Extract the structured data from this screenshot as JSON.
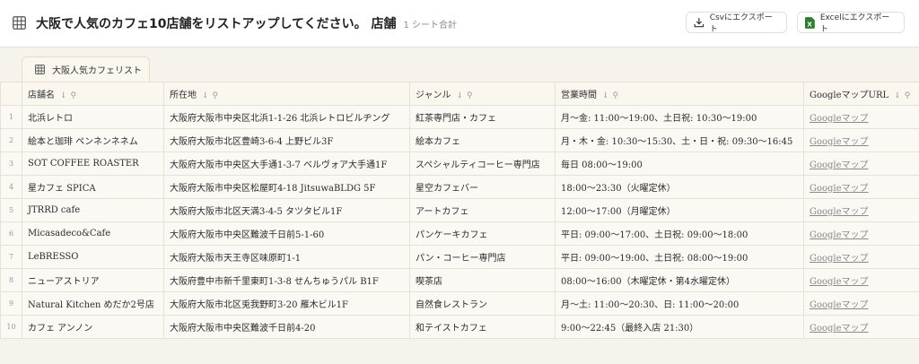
{
  "header": {
    "title": "大阪で人気のカフェ10店舗をリストアップしてください。 店舗",
    "sheet_count": "1 シート合計",
    "csv_label": "Csvにエクスポート",
    "excel_label": "Excelにエクスポート",
    "excel_color": "#2e7d32"
  },
  "tab": {
    "label": "大阪人気カフェリスト"
  },
  "table": {
    "columns": [
      "店舗名",
      "所在地",
      "ジャンル",
      "営業時間",
      "GoogleマップURL"
    ],
    "sort_glyph": "↓",
    "pin_glyph": "⚲",
    "rows": [
      {
        "n": "1",
        "name": "北浜レトロ",
        "address": "大阪府大阪市中央区北浜1-1-26 北浜レトロビルヂング",
        "genre": "紅茶専門店・カフェ",
        "hours": "月～金: 11:00～19:00、土日祝: 10:30～19:00",
        "url": "Googleマップ"
      },
      {
        "n": "2",
        "name": "絵本と珈琲 ペンネンネネム",
        "address": "大阪府大阪市北区豊崎3-6-4 上野ビル3F",
        "genre": "絵本カフェ",
        "hours": "月・木・金: 10:30～15:30、土・日・祝: 09:30～16:45",
        "url": "Googleマップ"
      },
      {
        "n": "3",
        "name": "SOT COFFEE ROASTER",
        "address": "大阪府大阪市中央区大手通1-3-7 ベルヴォア大手通1F",
        "genre": "スペシャルティコーヒー専門店",
        "hours": "毎日 08:00～19:00",
        "url": "Googleマップ"
      },
      {
        "n": "4",
        "name": "星カフェ SPICA",
        "address": "大阪府大阪市中央区松屋町4-18 JitsuwaBLDG 5F",
        "genre": "星空カフェバー",
        "hours": "18:00～23:30（火曜定休）",
        "url": "Googleマップ"
      },
      {
        "n": "5",
        "name": "JTRRD cafe",
        "address": "大阪府大阪市北区天満3-4-5 タツタビル1F",
        "genre": "アートカフェ",
        "hours": "12:00～17:00（月曜定休）",
        "url": "Googleマップ"
      },
      {
        "n": "6",
        "name": "Micasadeco&Cafe",
        "address": "大阪府大阪市中央区難波千日前5-1-60",
        "genre": "パンケーキカフェ",
        "hours": "平日: 09:00～17:00、土日祝: 09:00～18:00",
        "url": "Googleマップ"
      },
      {
        "n": "7",
        "name": "LeBRESSO",
        "address": "大阪府大阪市天王寺区味原町1-1",
        "genre": "パン・コーヒー専門店",
        "hours": "平日: 09:00～19:00、土日祝: 08:00～19:00",
        "url": "Googleマップ"
      },
      {
        "n": "8",
        "name": "ニューアストリア",
        "address": "大阪府豊中市新千里東町1-3-8 せんちゅうパル B1F",
        "genre": "喫茶店",
        "hours": "08:00～16:00（木曜定休・第4水曜定休）",
        "url": "Googleマップ"
      },
      {
        "n": "9",
        "name": "Natural Kitchen めだか2号店",
        "address": "大阪府大阪市北区兎我野町3-20 雁木ビル1F",
        "genre": "自然食レストラン",
        "hours": "月～土: 11:00～20:30、日: 11:00～20:00",
        "url": "Googleマップ"
      },
      {
        "n": "10",
        "name": "カフェ アンノン",
        "address": "大阪府大阪市中央区難波千日前4-20",
        "genre": "和テイストカフェ",
        "hours": "9:00～22:45（最終入店 21:30）",
        "url": "Googleマップ"
      }
    ]
  }
}
